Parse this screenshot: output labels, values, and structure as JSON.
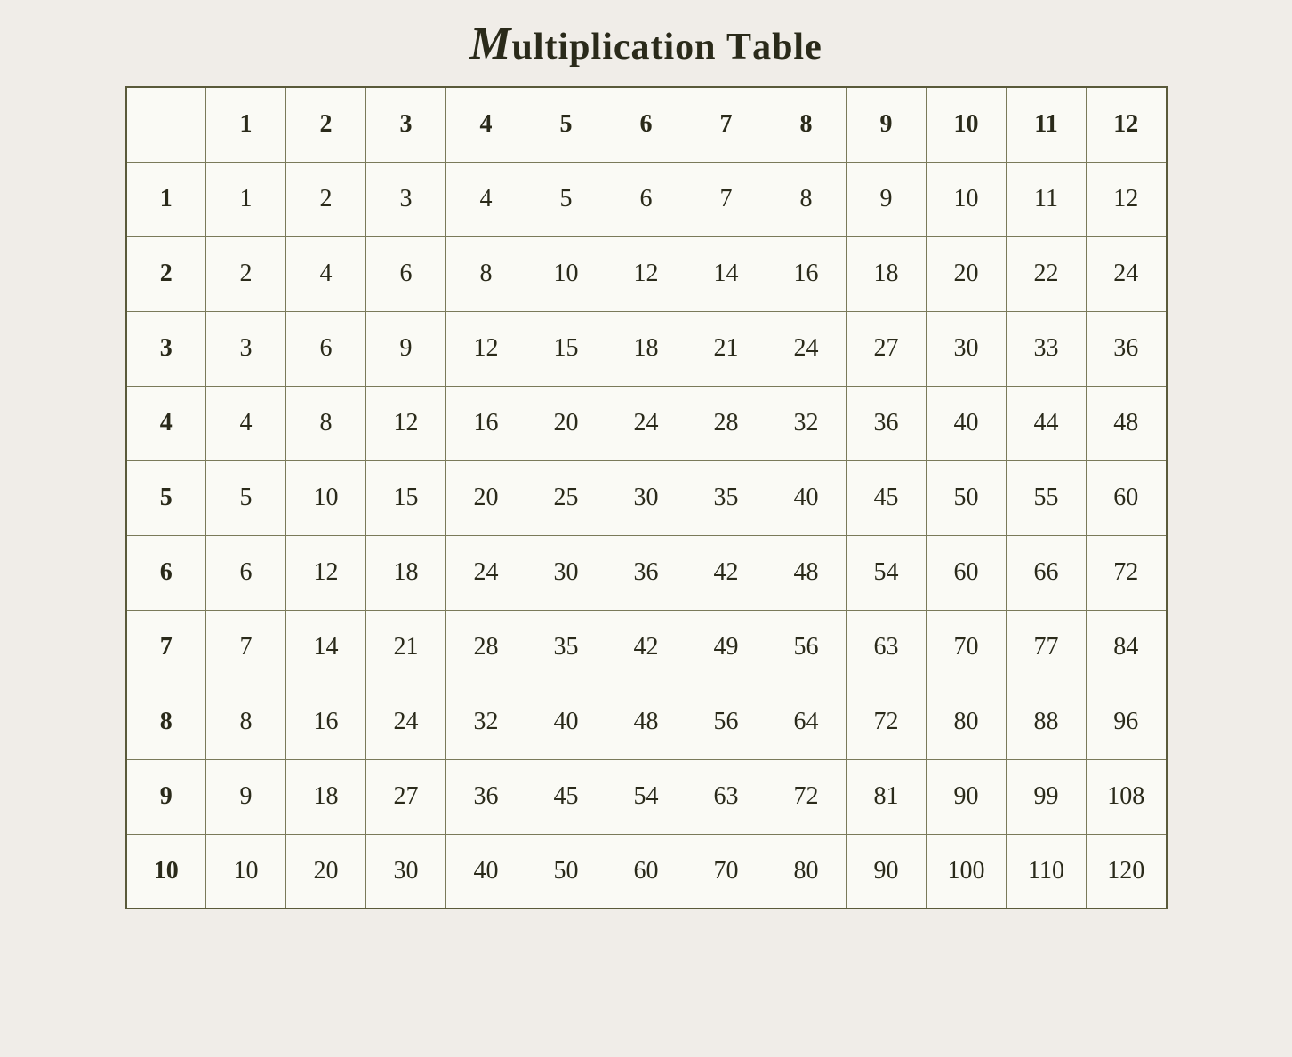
{
  "title": "Multiplication Table",
  "table": {
    "col_headers": [
      "",
      "1",
      "2",
      "3",
      "4",
      "5",
      "6",
      "7",
      "8",
      "9",
      "10",
      "11",
      "12"
    ],
    "rows": [
      {
        "row_header": "1",
        "values": [
          1,
          2,
          3,
          4,
          5,
          6,
          7,
          8,
          9,
          10,
          11,
          12
        ]
      },
      {
        "row_header": "2",
        "values": [
          2,
          4,
          6,
          8,
          10,
          12,
          14,
          16,
          18,
          20,
          22,
          24
        ]
      },
      {
        "row_header": "3",
        "values": [
          3,
          6,
          9,
          12,
          15,
          18,
          21,
          24,
          27,
          30,
          33,
          36
        ]
      },
      {
        "row_header": "4",
        "values": [
          4,
          8,
          12,
          16,
          20,
          24,
          28,
          32,
          36,
          40,
          44,
          48
        ]
      },
      {
        "row_header": "5",
        "values": [
          5,
          10,
          15,
          20,
          25,
          30,
          35,
          40,
          45,
          50,
          55,
          60
        ]
      },
      {
        "row_header": "6",
        "values": [
          6,
          12,
          18,
          24,
          30,
          36,
          42,
          48,
          54,
          60,
          66,
          72
        ]
      },
      {
        "row_header": "7",
        "values": [
          7,
          14,
          21,
          28,
          35,
          42,
          49,
          56,
          63,
          70,
          77,
          84
        ]
      },
      {
        "row_header": "8",
        "values": [
          8,
          16,
          24,
          32,
          40,
          48,
          56,
          64,
          72,
          80,
          88,
          96
        ]
      },
      {
        "row_header": "9",
        "values": [
          9,
          18,
          27,
          36,
          45,
          54,
          63,
          72,
          81,
          90,
          99,
          108
        ]
      },
      {
        "row_header": "10",
        "values": [
          10,
          20,
          30,
          40,
          50,
          60,
          70,
          80,
          90,
          100,
          110,
          120
        ]
      }
    ]
  }
}
